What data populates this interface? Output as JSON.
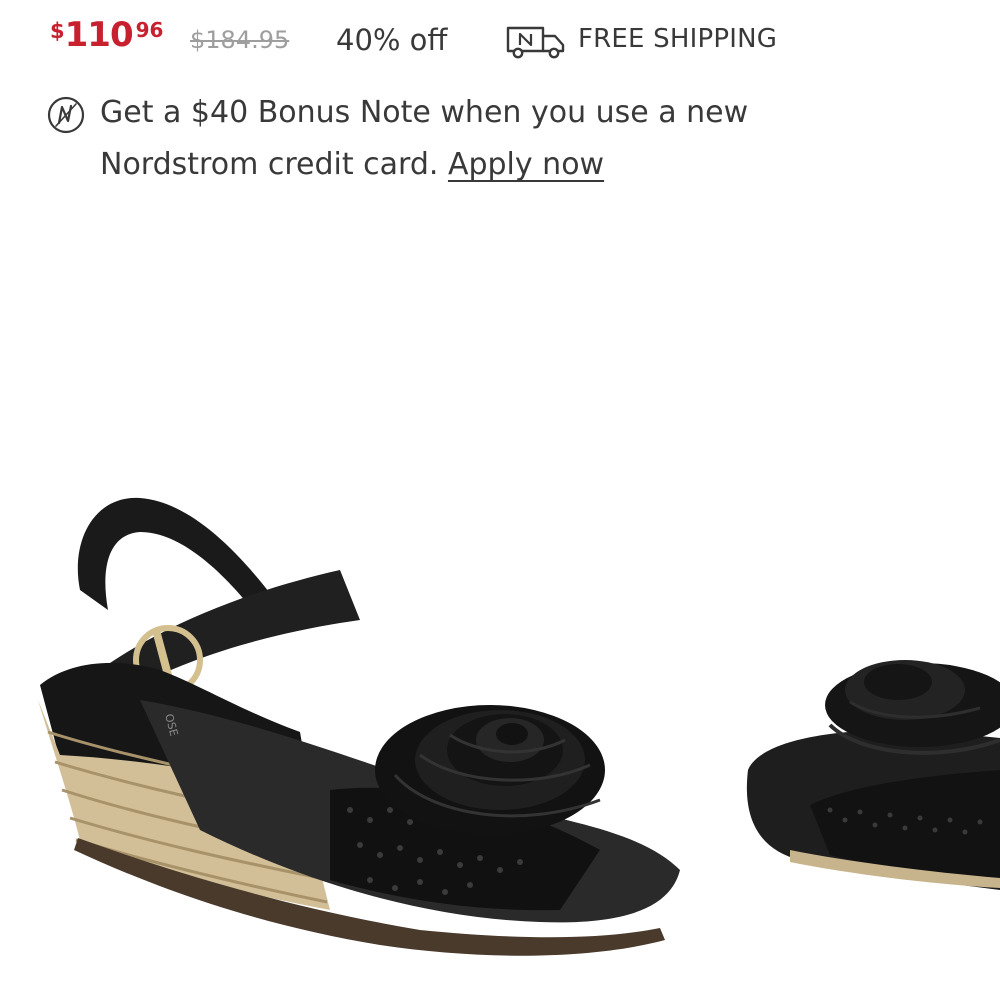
{
  "price": {
    "sale_currency": "$",
    "sale_whole": "110",
    "sale_cents": "96",
    "original": "$184.95",
    "discount": "40% off"
  },
  "shipping": {
    "icon": "delivery-truck-icon",
    "label": "FREE SHIPPING"
  },
  "bonus_note": {
    "icon": "nordstrom-note-icon",
    "text": "Get a $40 Bonus Note when you use a new Nordstrom credit card.",
    "link_label": "Apply now"
  },
  "product_image": {
    "description_icon": "wedge-sandal-image",
    "logo_text": "OSE"
  },
  "colors": {
    "sale_red": "#c8202e",
    "text": "#393939",
    "muted": "#9e9e9e"
  }
}
